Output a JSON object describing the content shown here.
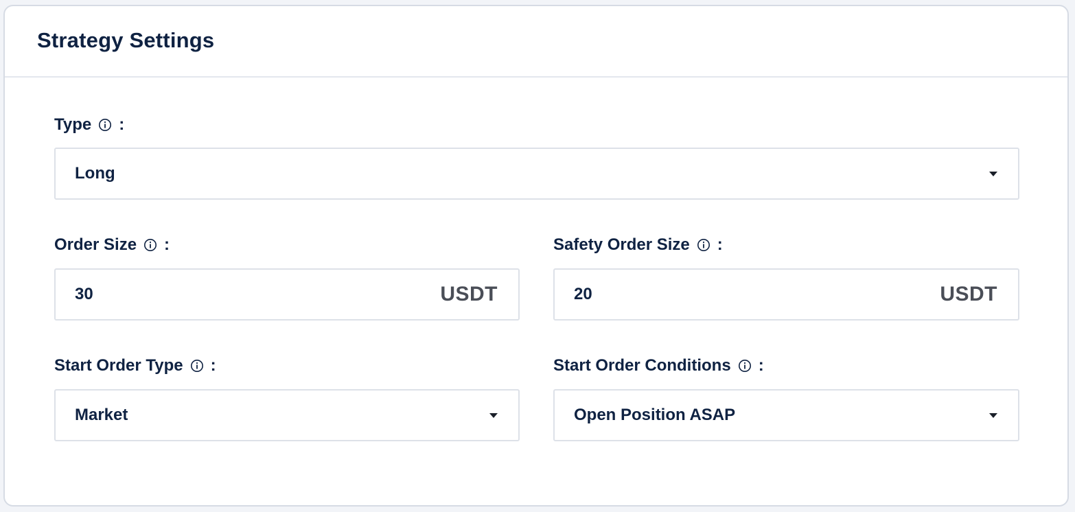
{
  "panel": {
    "title": "Strategy Settings"
  },
  "fields": {
    "type": {
      "label": "Type",
      "colon": ":",
      "value": "Long"
    },
    "order_size": {
      "label": "Order Size",
      "colon": ":",
      "value": "30",
      "unit": "USDT"
    },
    "safety_order_size": {
      "label": "Safety Order Size",
      "colon": ":",
      "value": "20",
      "unit": "USDT"
    },
    "start_order_type": {
      "label": "Start Order Type",
      "colon": ":",
      "value": "Market"
    },
    "start_order_conditions": {
      "label": "Start Order Conditions",
      "colon": ":",
      "value": "Open Position ASAP"
    }
  },
  "icons": {
    "info": "info-circle-icon",
    "dropdown": "caret-down-icon"
  },
  "colors": {
    "text": "#0f2242",
    "unit_text": "#4a4e57",
    "border": "#dde1e8",
    "card_border": "#d6dbe4",
    "background": "#ffffff"
  }
}
